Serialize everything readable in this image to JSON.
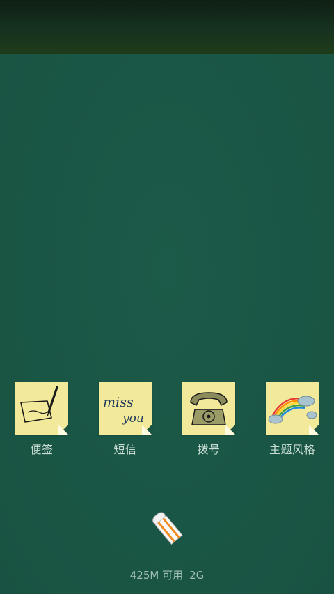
{
  "apps": [
    {
      "label": "便签",
      "icon": "pen-paper-note-icon"
    },
    {
      "label": "短信",
      "icon": "miss-you-note-icon",
      "note_text_1": "miss",
      "note_text_2": "you"
    },
    {
      "label": "拨号",
      "icon": "telephone-note-icon"
    },
    {
      "label": "主题风格",
      "icon": "rainbow-note-icon"
    }
  ],
  "status": {
    "memory": "425M 可用",
    "network": "2G"
  },
  "colors": {
    "board": "#1b5746",
    "note": "#f3e99a",
    "label": "#c9ddd5"
  }
}
